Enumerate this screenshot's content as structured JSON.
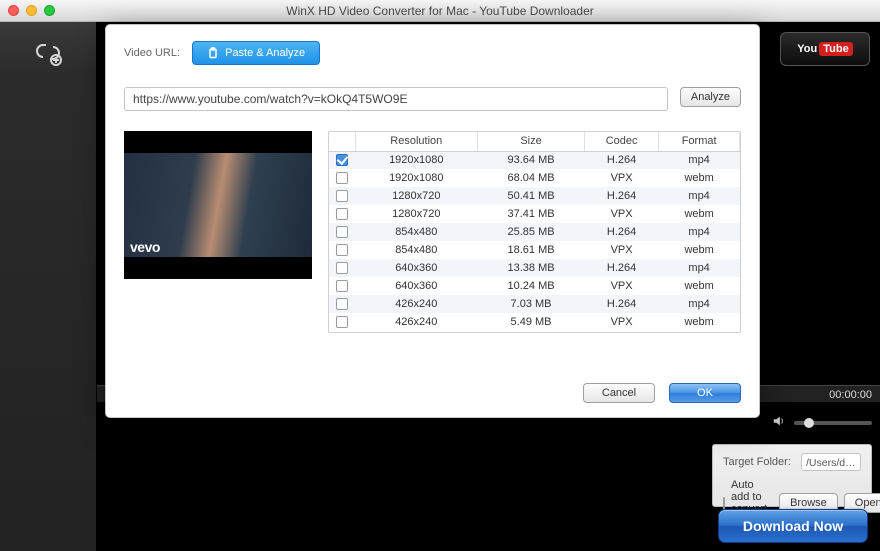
{
  "window": {
    "title": "WinX HD Video Converter for Mac - YouTube Downloader"
  },
  "youtube_badge": {
    "you": "You",
    "tube": "Tube"
  },
  "player": {
    "time": "00:00:00"
  },
  "bottom": {
    "target_folder_label": "Target Folder:",
    "target_folder_path": "/Users/dinosaur/Movies/Mac Video Library",
    "auto_add_label": "Auto add to convert list",
    "browse": "Browse",
    "open": "Open"
  },
  "download_now": "Download Now",
  "dialog": {
    "video_url_label": "Video URL:",
    "paste_analyze": "Paste & Analyze",
    "url": "https://www.youtube.com/watch?v=kOkQ4T5WO9E",
    "analyze": "Analyze",
    "thumb_logo": "vevo",
    "headers": {
      "resolution": "Resolution",
      "size": "Size",
      "codec": "Codec",
      "format": "Format"
    },
    "rows": [
      {
        "checked": true,
        "resolution": "1920x1080",
        "size": "93.64 MB",
        "codec": "H.264",
        "format": "mp4"
      },
      {
        "checked": false,
        "resolution": "1920x1080",
        "size": "68.04 MB",
        "codec": "VPX",
        "format": "webm"
      },
      {
        "checked": false,
        "resolution": "1280x720",
        "size": "50.41 MB",
        "codec": "H.264",
        "format": "mp4"
      },
      {
        "checked": false,
        "resolution": "1280x720",
        "size": "37.41 MB",
        "codec": "VPX",
        "format": "webm"
      },
      {
        "checked": false,
        "resolution": "854x480",
        "size": "25.85 MB",
        "codec": "H.264",
        "format": "mp4"
      },
      {
        "checked": false,
        "resolution": "854x480",
        "size": "18.61 MB",
        "codec": "VPX",
        "format": "webm"
      },
      {
        "checked": false,
        "resolution": "640x360",
        "size": "13.38 MB",
        "codec": "H.264",
        "format": "mp4"
      },
      {
        "checked": false,
        "resolution": "640x360",
        "size": "10.24 MB",
        "codec": "VPX",
        "format": "webm"
      },
      {
        "checked": false,
        "resolution": "426x240",
        "size": "7.03 MB",
        "codec": "H.264",
        "format": "mp4"
      },
      {
        "checked": false,
        "resolution": "426x240",
        "size": "5.49 MB",
        "codec": "VPX",
        "format": "webm"
      }
    ],
    "cancel": "Cancel",
    "ok": "OK"
  }
}
